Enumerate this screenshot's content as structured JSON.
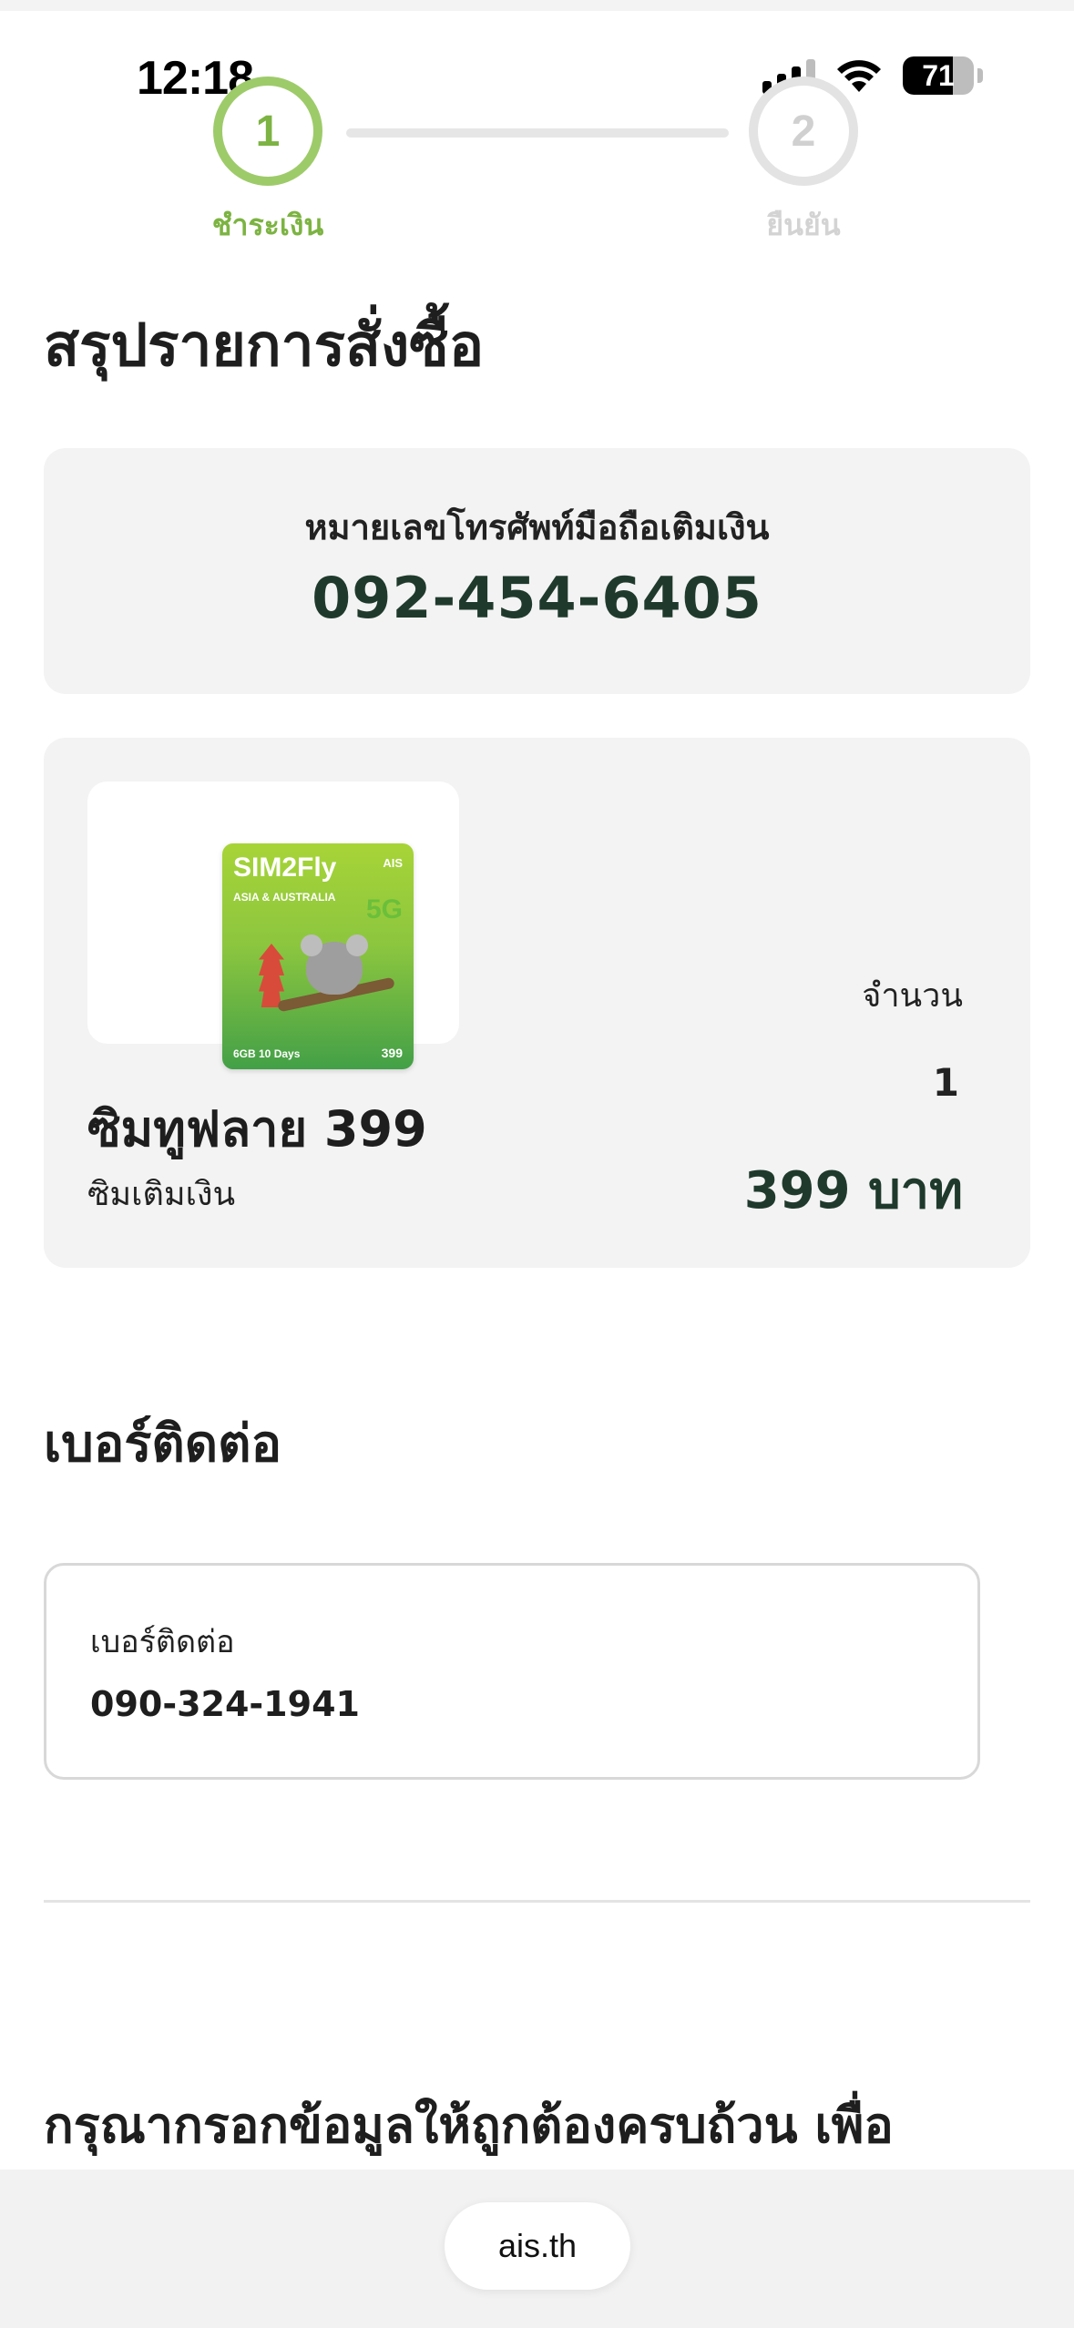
{
  "status_bar": {
    "time": "12:18",
    "battery": "71",
    "battery_level": 0.71
  },
  "stepper": {
    "steps": [
      {
        "number": "1",
        "label": "ชำระเงิน",
        "state": "active"
      },
      {
        "number": "2",
        "label": "ยืนยัน",
        "state": "inactive"
      }
    ]
  },
  "summary": {
    "title": "สรุปรายการสั่งซื้อ",
    "phone_label": "หมายเลขโทรศัพท์มือถือเติมเงิน",
    "phone_number": "092-454-6405"
  },
  "product": {
    "image": {
      "title": "SIM2Fly",
      "subtitle": "ASIA & AUSTRALIA",
      "brand": "AIS",
      "network": "5G",
      "data": "6GB 10 Days",
      "price": "399"
    },
    "name": "ซิมทูฟลาย 399",
    "type": "ซิมเติมเงิน",
    "quantity_label": "จำนวน",
    "quantity": "1",
    "price": "399 บาท"
  },
  "contact": {
    "section_title": "เบอร์ติดต่อ",
    "field_label": "เบอร์ติดต่อ",
    "field_value": "090-324-1941"
  },
  "notice_text": "กรุณากรอกข้อมูลให้ถูกต้องครบถ้วน เพื่อ",
  "browser": {
    "url": "ais.th"
  },
  "colors": {
    "accent_green": "#7cb342",
    "dark_green_text": "#1f3a2c",
    "card_bg": "#f3f3f3"
  }
}
